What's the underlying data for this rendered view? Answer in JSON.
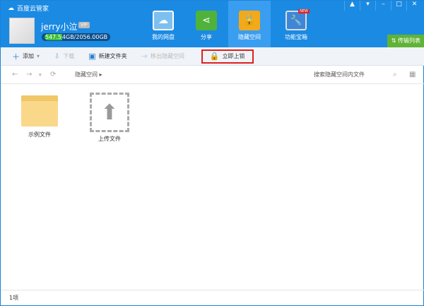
{
  "app": {
    "title": "百度云管家"
  },
  "user": {
    "name": "jerry小泣",
    "vip": "VIP",
    "quota_used": "547.5",
    "quota_rest": "4GB/2056.00GB"
  },
  "tabs": [
    {
      "label": "我的网盘",
      "icon": "cloud-icon"
    },
    {
      "label": "分享",
      "icon": "share-icon"
    },
    {
      "label": "隐藏空间",
      "icon": "lock-shield-icon"
    },
    {
      "label": "功能宝箱",
      "icon": "wrench-icon",
      "badge": "NEW"
    }
  ],
  "transfer": "传输列表",
  "toolbar": {
    "add": "添加",
    "download": "下载",
    "new_folder": "新建文件夹",
    "move_out": "移出隐藏空间",
    "lock_now": "立即上锁"
  },
  "nav": {
    "breadcrumb": "隐藏空间",
    "search_placeholder": "搜索隐藏空间内文件"
  },
  "items": [
    {
      "label": "示例文件"
    },
    {
      "label": "上传文件"
    }
  ],
  "status": "1项"
}
